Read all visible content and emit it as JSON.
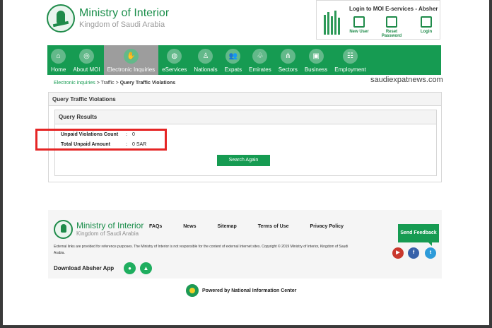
{
  "header": {
    "ministry_title": "Ministry of Interior",
    "ministry_subtitle": "Kingdom of Saudi Arabia",
    "absher_title": "Login to MOI E-services - Absher",
    "actions": [
      "New User",
      "Reset Password",
      "Login"
    ]
  },
  "nav": {
    "items": [
      {
        "label": "Home",
        "icon": "home-icon"
      },
      {
        "label": "About MOI",
        "icon": "emblem-icon"
      },
      {
        "label": "Electronic Inquiries",
        "icon": "inquiry-icon"
      },
      {
        "label": "eServices",
        "icon": "globe-icon"
      },
      {
        "label": "Nationals",
        "icon": "person-icon"
      },
      {
        "label": "Expats",
        "icon": "people-icon"
      },
      {
        "label": "Emirates",
        "icon": "palm-icon"
      },
      {
        "label": "Sectors",
        "icon": "share-icon"
      },
      {
        "label": "Business",
        "icon": "briefcase-icon"
      },
      {
        "label": "Employment",
        "icon": "group-icon"
      }
    ]
  },
  "breadcrumb": {
    "item_1": "Electronic inquiries",
    "sep_1": ">",
    "item_2": "Traffic",
    "sep_2": ">",
    "item_3": "Query Traffic Violations"
  },
  "watermark": "saudiexpatnews.com",
  "panel": {
    "title": "Query Traffic Violations",
    "results_title": "Query Results",
    "rows": [
      {
        "label": "Unpaid Violations Count",
        "colon": ":",
        "value": "0"
      },
      {
        "label": "Total Unpaid Amount",
        "colon": ":",
        "value": "0 SAR"
      }
    ],
    "button": "Search Again"
  },
  "footer": {
    "title": "Ministry of Interior",
    "subtitle": "Kingdom of Saudi Arabia",
    "links": [
      "FAQs",
      "News",
      "Sitemap",
      "Terms of Use",
      "Privacy Policy"
    ],
    "disclaimer": "External links are provided for reference purposes. The Ministry of Interior is not responsible for the content of external Internet sites. Copyright © 2019 Ministry of Interior, Kingdom of Saudi Arabia.",
    "download_label": "Download Absher App",
    "feedback": "Send Feedback"
  },
  "powered": "Powered by National Information Center",
  "colors": {
    "primary_green": "#169b52",
    "highlight_red": "#e52525",
    "active_nav_gray": "#9d9d9d"
  }
}
